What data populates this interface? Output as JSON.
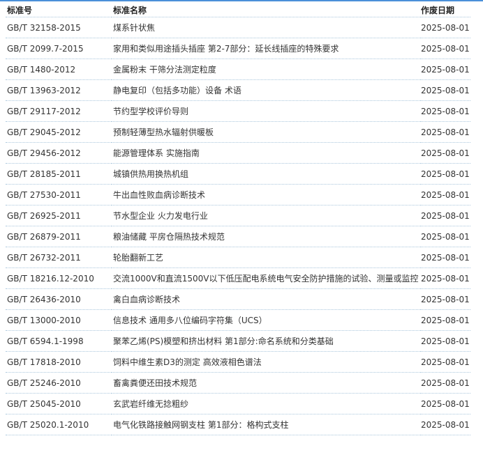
{
  "table": {
    "headers": {
      "code": "标准号",
      "name": "标准名称",
      "date": "作废日期"
    },
    "rows": [
      {
        "code": "GB/T 32158-2015",
        "name": "煤系针状焦",
        "date": "2025-08-01"
      },
      {
        "code": "GB/T 2099.7-2015",
        "name": "家用和类似用途插头插座 第2-7部分：延长线插座的特殊要求",
        "date": "2025-08-01"
      },
      {
        "code": "GB/T 1480-2012",
        "name": "金属粉末 干筛分法测定粒度",
        "date": "2025-08-01"
      },
      {
        "code": "GB/T 13963-2012",
        "name": "静电复印（包括多功能）设备 术语",
        "date": "2025-08-01"
      },
      {
        "code": "GB/T 29117-2012",
        "name": "节约型学校评价导则",
        "date": "2025-08-01"
      },
      {
        "code": "GB/T 29045-2012",
        "name": "预制轻薄型热水辐射供暖板",
        "date": "2025-08-01"
      },
      {
        "code": "GB/T 29456-2012",
        "name": "能源管理体系 实施指南",
        "date": "2025-08-01"
      },
      {
        "code": "GB/T 28185-2011",
        "name": "城镇供热用换热机组",
        "date": "2025-08-01"
      },
      {
        "code": "GB/T 27530-2011",
        "name": "牛出血性败血病诊断技术",
        "date": "2025-08-01"
      },
      {
        "code": "GB/T 26925-2011",
        "name": "节水型企业 火力发电行业",
        "date": "2025-08-01"
      },
      {
        "code": "GB/T 26879-2011",
        "name": "粮油储藏 平房仓隔热技术规范",
        "date": "2025-08-01"
      },
      {
        "code": "GB/T 26732-2011",
        "name": "轮胎翻新工艺",
        "date": "2025-08-01"
      },
      {
        "code": "GB/T 18216.12-2010",
        "name": "交流1000V和直流1500V以下低压配电系统电气安全防护措施的试验、测量或监控",
        "date": "2025-08-01"
      },
      {
        "code": "GB/T 26436-2010",
        "name": "禽白血病诊断技术",
        "date": "2025-08-01"
      },
      {
        "code": "GB/T 13000-2010",
        "name": "信息技术 通用多八位编码字符集（UCS）",
        "date": "2025-08-01"
      },
      {
        "code": "GB/T 6594.1-1998",
        "name": "聚苯乙烯(PS)模塑和挤出材料 第1部分:命名系统和分类基础",
        "date": "2025-08-01"
      },
      {
        "code": "GB/T 17818-2010",
        "name": "饲料中维生素D3的测定 高效液相色谱法",
        "date": "2025-08-01"
      },
      {
        "code": "GB/T 25246-2010",
        "name": "畜禽粪便还田技术规范",
        "date": "2025-08-01"
      },
      {
        "code": "GB/T 25045-2010",
        "name": "玄武岩纤维无捻粗纱",
        "date": "2025-08-01"
      },
      {
        "code": "GB/T 25020.1-2010",
        "name": "电气化铁路接触网钢支柱 第1部分：格构式支柱",
        "date": "2025-08-01"
      }
    ]
  }
}
